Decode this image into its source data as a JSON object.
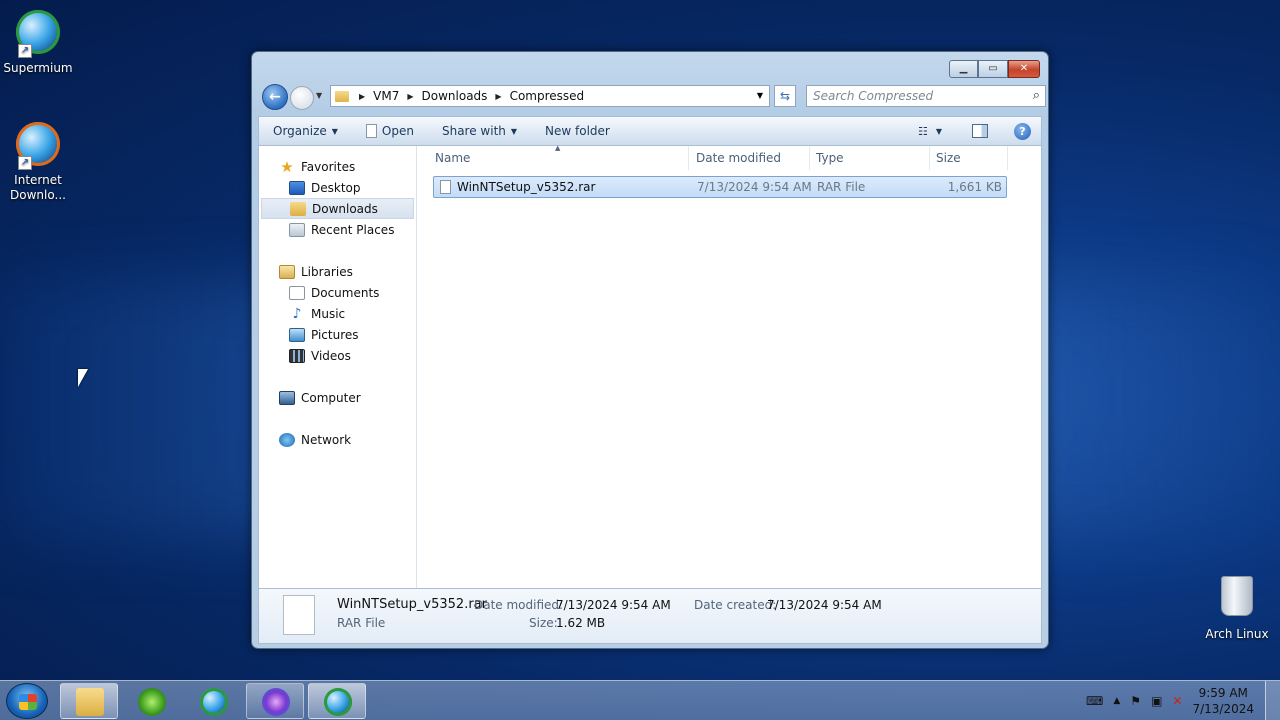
{
  "desktop": {
    "icons": [
      {
        "label": "Supermium"
      },
      {
        "label": "Internet Downlo..."
      },
      {
        "label": "Arch Linux"
      }
    ]
  },
  "window": {
    "breadcrumbs": [
      "VM7",
      "Downloads",
      "Compressed"
    ],
    "search_placeholder": "Search Compressed",
    "toolbar": {
      "organize": "Organize",
      "open": "Open",
      "share_with": "Share with",
      "new_folder": "New folder"
    },
    "nav": {
      "favorites": "Favorites",
      "desktop": "Desktop",
      "downloads": "Downloads",
      "recent_places": "Recent Places",
      "libraries": "Libraries",
      "documents": "Documents",
      "music": "Music",
      "pictures": "Pictures",
      "videos": "Videos",
      "computer": "Computer",
      "network": "Network"
    },
    "columns": {
      "name": "Name",
      "date_modified": "Date modified",
      "type": "Type",
      "size": "Size"
    },
    "files": [
      {
        "name": "WinNTSetup_v5352.rar",
        "date_modified": "7/13/2024 9:54 AM",
        "type": "RAR File",
        "size": "1,661 KB"
      }
    ],
    "details": {
      "filename": "WinNTSetup_v5352.rar",
      "filetype": "RAR File",
      "date_modified_label": "Date modified:",
      "date_modified": "7/13/2024 9:54 AM",
      "size_label": "Size:",
      "size": "1.62 MB",
      "date_created_label": "Date created:",
      "date_created": "7/13/2024 9:54 AM"
    }
  },
  "taskbar": {
    "time": "9:59 AM",
    "date": "7/13/2024"
  }
}
